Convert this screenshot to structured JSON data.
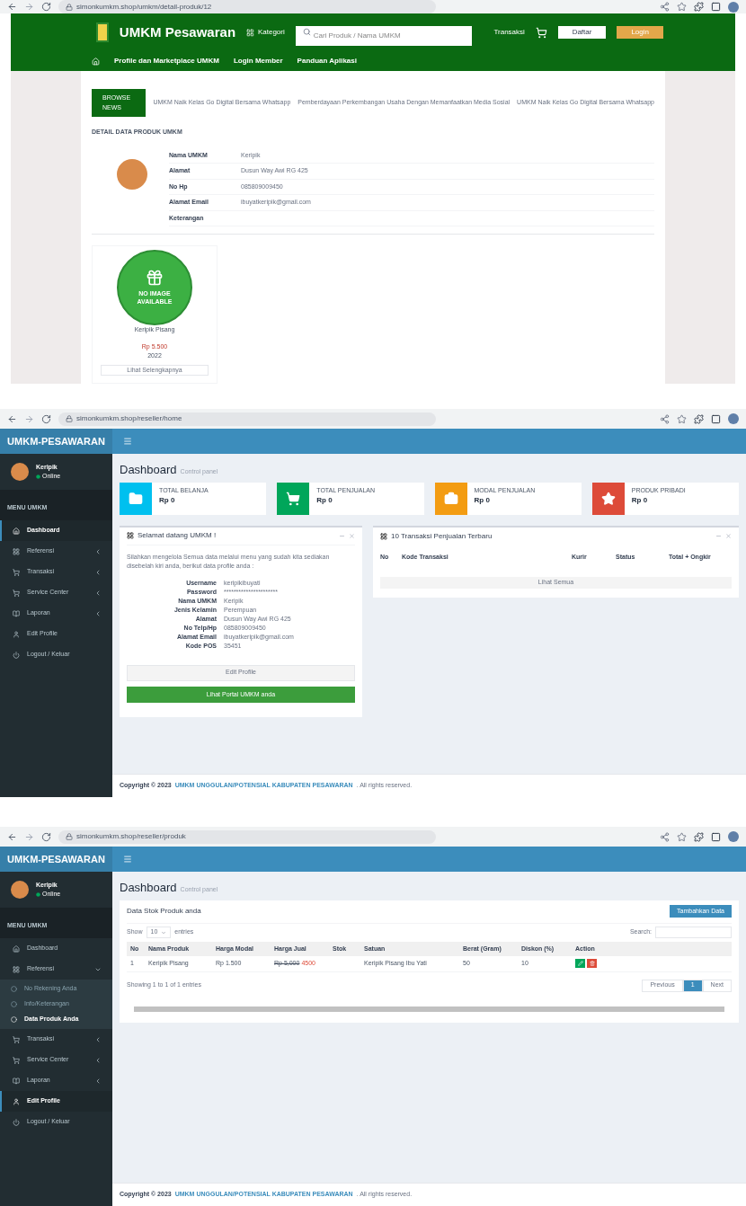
{
  "portal": {
    "url": "simonkumkm.shop/umkm/detail-produk/12",
    "brand": "UMKM Pesawaran",
    "category": "Kategori",
    "search": {
      "placeholder": "Cari Produk / Nama UMKM"
    },
    "transaction": "Transaksi",
    "buttons": [
      "Daftar",
      "Login"
    ],
    "nav": [
      "Profile dan Marketplace UMKM",
      "Login Member",
      "Panduan Aplikasi"
    ],
    "news_tag": "BROWSE NEWS",
    "news": [
      "UMKM Naik Kelas Go Digital Bersama Whatsapp",
      "Pemberdayaan Perkembangan Usaha Dengan Memanfaatkan Media Sosial",
      "UMKM Naik Kelas Go Digital Bersama Whatsapp"
    ],
    "detail_title": "DETAIL DATA PRODUK UMKM",
    "details": [
      {
        "label": "Nama UMKM",
        "value": "Keripik"
      },
      {
        "label": "Alamat",
        "value": "Dusun Way Awi RG 425"
      },
      {
        "label": "No Hp",
        "value": "085809009450"
      },
      {
        "label": "Alamat Email",
        "value": "ibuyatkeripik@gmail.com"
      },
      {
        "label": "Keterangan"
      }
    ],
    "product": {
      "image_text": "NO IMAGE AVAILABLE",
      "name": "Keripik Pisang",
      "price": "Rp 5.500",
      "year": "2022",
      "link": "Lihat Selengkapnya"
    }
  },
  "dashboard": {
    "url": "simonkumkm.shop/reseller/home",
    "brand": "UMKM-PESAWARAN",
    "user": "Keripik",
    "status": "Online",
    "menu_header": "MENU UMKM",
    "sidebar": [
      {
        "label": "Dashboard",
        "selected": true
      },
      {
        "label": "Referensi",
        "selected": false,
        "expanded": false
      },
      {
        "label": "Transaksi",
        "selected": false,
        "expanded": false
      },
      {
        "label": "Service Center",
        "selected": false,
        "expanded": false
      },
      {
        "label": "Laporan",
        "selected": false,
        "expanded": false
      },
      {
        "label": "Edit Profile",
        "selected": false
      },
      {
        "label": "Logout / Keluar",
        "selected": false
      }
    ],
    "title": "Dashboard",
    "subtitle": "Control panel",
    "stats": [
      {
        "label": "TOTAL BELANJA",
        "value": "Rp 0",
        "color": "#00c0ef"
      },
      {
        "label": "TOTAL PENJUALAN",
        "value": "Rp 0",
        "color": "#00a65a"
      },
      {
        "label": "MODAL PENJUALAN",
        "value": "Rp 0",
        "color": "#f39c12"
      },
      {
        "label": "PRODUK PRIBADI",
        "value": "Rp 0",
        "color": "#dd4b39"
      }
    ],
    "welcome": {
      "title": "Selamat datang UMKM !",
      "intro": "Silahkan mengelola Semua data melalui menu yang sudah kita sediakan disebelah kiri anda, berikut data profile anda :",
      "fields": [
        {
          "label": "Username",
          "value": "keripikibuyati"
        },
        {
          "label": "Password",
          "value": "**********************"
        },
        {
          "label": "Nama UMKM",
          "value": "Keripik"
        },
        {
          "label": "Jenis Kelamin",
          "value": "Perempuan"
        },
        {
          "label": "Alamat",
          "value": "Dusun Way Awi RG 425"
        },
        {
          "label": "No Telp/Hp",
          "value": "085809009450"
        },
        {
          "label": "Alamat Email",
          "value": "ibuyatkeripik@gmail.com"
        },
        {
          "label": "Kode POS",
          "value": "35451"
        }
      ],
      "edit_button": "Edit Profile",
      "portal_button": "Lihat Portal UMKM anda"
    },
    "transactions": {
      "title": "10 Transaksi Penjualan Terbaru",
      "columns": [
        "No",
        "Kode Transaksi",
        "Kurir",
        "Status",
        "Total + Ongkir"
      ],
      "footer": "Lihat Semua"
    },
    "copyright": "Copyright © 2023",
    "copyright_link": "UMKM UNGGULAN/POTENSIAL KABUPATEN PESAWARAN",
    "copyright_tail": ". All rights reserved."
  },
  "products": {
    "url": "simonkumkm.shop/reseller/produk",
    "brand": "UMKM-PESAWARAN",
    "user": "Keripik",
    "status": "Online",
    "menu_header": "MENU UMKM",
    "sidebar": [
      {
        "label": "Dashboard",
        "selected": false
      },
      {
        "label": "Referensi",
        "selected": false,
        "expanded": true,
        "children": [
          {
            "label": "No Rekening Anda",
            "selected": false
          },
          {
            "label": "Info/Keterangan",
            "selected": false
          },
          {
            "label": "Data Produk Anda",
            "selected": true
          }
        ]
      },
      {
        "label": "Transaksi",
        "selected": false,
        "expanded": false
      },
      {
        "label": "Service Center",
        "selected": false,
        "expanded": false
      },
      {
        "label": "Laporan",
        "selected": false,
        "expanded": false
      },
      {
        "label": "Edit Profile",
        "selected": true
      },
      {
        "label": "Logout / Keluar",
        "selected": false
      }
    ],
    "title": "Dashboard",
    "subtitle": "Control panel",
    "box_title": "Data Stok Produk anda",
    "add_button": "Tambahkan Data",
    "show": "Show",
    "page_size": "10",
    "entries": "entries",
    "search_label": "Search:",
    "columns": [
      "No",
      "Nama Produk",
      "Harga Modal",
      "Harga Jual",
      "Stok",
      "Satuan",
      "Berat (Gram)",
      "Diskon (%)",
      "Action"
    ],
    "rows": [
      {
        "no": "1",
        "name": "Keripik Pisang",
        "cost": "Rp 1.500",
        "price_old": "Rp 5,000",
        "price_new": "4500",
        "unit": "Keripik Pisang Ibu Yati",
        "weight": "50",
        "discount": "10"
      }
    ],
    "info": "Showing 1 to 1 of 1 entries",
    "pager": [
      {
        "label": "Previous",
        "selected": false
      },
      {
        "label": "1",
        "selected": true
      },
      {
        "label": "Next",
        "selected": false
      }
    ],
    "copyright": "Copyright © 2023",
    "copyright_link": "UMKM UNGGULAN/POTENSIAL KABUPATEN PESAWARAN",
    "copyright_tail": ". All rights reserved."
  }
}
